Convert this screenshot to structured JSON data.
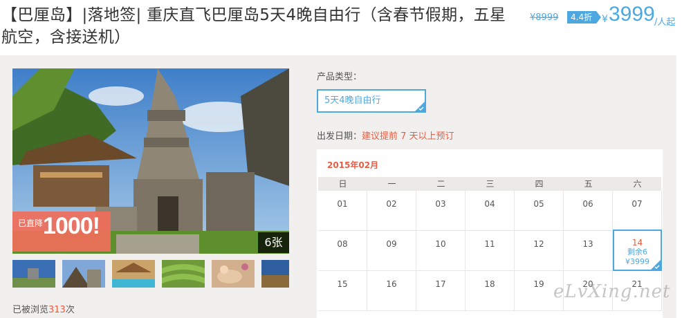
{
  "header": {
    "title": "【巴厘岛】|落地签| 重庆直飞巴厘岛5天4晚自由行（含春节假期，五星航空，含接送机）",
    "original_price": "¥8999",
    "discount": "4.4折",
    "currency": "¥",
    "price": "3999",
    "price_unit": "/人起"
  },
  "gallery": {
    "promo_small": "已直降",
    "promo_big": "1000!",
    "photo_count": "6张",
    "views_prefix": "已被浏览",
    "views_count": "313",
    "views_suffix": "次"
  },
  "booking": {
    "type_label": "产品类型：",
    "type_option": "5天4晚自由行",
    "date_label": "出发日期：",
    "date_hint": "建议提前 7 天以上预订"
  },
  "calendar": {
    "month": "2015年02月",
    "weekdays": [
      "日",
      "一",
      "二",
      "三",
      "四",
      "五",
      "六"
    ],
    "row1": [
      "01",
      "02",
      "03",
      "04",
      "05",
      "06",
      "07"
    ],
    "row2": [
      "08",
      "09",
      "10",
      "11",
      "12",
      "13",
      "14"
    ],
    "row3": [
      "15",
      "16",
      "17",
      "18",
      "19",
      "20",
      "21"
    ],
    "selected_remain": "剩余6",
    "selected_price": "¥3999"
  },
  "watermark": "eLvXing.net",
  "colors": {
    "accent": "#4ea8e0",
    "highlight": "#e85c41",
    "panel": "#f1f0ee"
  }
}
